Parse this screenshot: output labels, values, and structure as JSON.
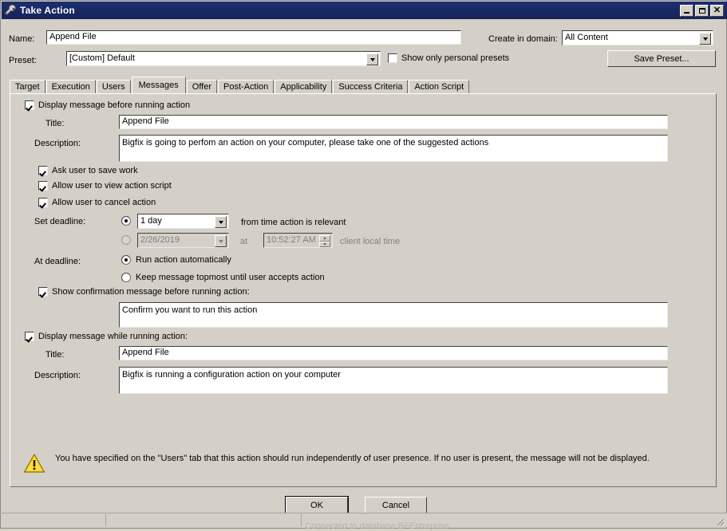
{
  "window": {
    "title": "Take Action",
    "icon": "wrench-icon",
    "controls": {
      "minimize": "–",
      "maximize": "□",
      "close": "✕"
    }
  },
  "header": {
    "name_label": "Name:",
    "name_value": "Append File",
    "preset_label": "Preset:",
    "preset_value": "[Custom] Default",
    "show_personal_presets_label": "Show only personal presets",
    "show_personal_presets_checked": false,
    "create_in_domain_label": "Create in domain:",
    "create_in_domain_value": "All Content",
    "save_preset_label": "Save Preset..."
  },
  "tabs": [
    {
      "label": "Target",
      "active": false
    },
    {
      "label": "Execution",
      "active": false
    },
    {
      "label": "Users",
      "active": false
    },
    {
      "label": "Messages",
      "active": true
    },
    {
      "label": "Offer",
      "active": false
    },
    {
      "label": "Post-Action",
      "active": false
    },
    {
      "label": "Applicability",
      "active": false
    },
    {
      "label": "Success Criteria",
      "active": false
    },
    {
      "label": "Action Script",
      "active": false
    }
  ],
  "messages": {
    "display_before_label": "Display message before running action",
    "display_before_checked": true,
    "title_label": "Title:",
    "title_value": "Append File",
    "description_label": "Description:",
    "description_value": "Bigfix is going to perfom an action on your computer, please take one of the suggested actions",
    "ask_save_label": "Ask user to save work",
    "ask_save_checked": true,
    "view_script_label": "Allow user to view action script",
    "view_script_checked": true,
    "cancel_action_label": "Allow user to cancel action",
    "cancel_action_checked": true,
    "set_deadline_label": "Set deadline:",
    "deadline_relative_selected": true,
    "deadline_relative_value": "1 day",
    "deadline_relative_suffix": "from time action is relevant",
    "deadline_absolute_selected": false,
    "deadline_date_value": "2/26/2019",
    "deadline_at_label": "at",
    "deadline_time_value": "10:52:27 AM",
    "deadline_client_local_label": "client local time",
    "at_deadline_label": "At deadline:",
    "run_automatically_label": "Run action automatically",
    "run_automatically_selected": true,
    "keep_topmost_label": "Keep message topmost until user accepts action",
    "keep_topmost_selected": false,
    "show_confirmation_label": "Show confirmation message before running action:",
    "show_confirmation_checked": true,
    "confirmation_value": "Confirm you want to run this  action",
    "display_while_label": "Display message while running action:",
    "display_while_checked": true,
    "while_title_label": "Title:",
    "while_title_value": "Append File",
    "while_description_label": "Description:",
    "while_description_value": "Bigfix is running a configuration action on your computer"
  },
  "warning": {
    "icon": "warning-triangle-icon",
    "text": "You have specified on the \"Users\" tab that this action should run independently of user presence. If no user is present, the message will not be displayed."
  },
  "footer": {
    "ok_label": "OK",
    "cancel_label": "Cancel"
  },
  "statusbar": {
    "text": "Connected to database BFEnterprise"
  },
  "colors": {
    "titlebar": "#1d2e70",
    "face": "#d4d0c8",
    "field": "#ffffff",
    "disabled_text": "#808080",
    "warning": "#f2c200"
  }
}
